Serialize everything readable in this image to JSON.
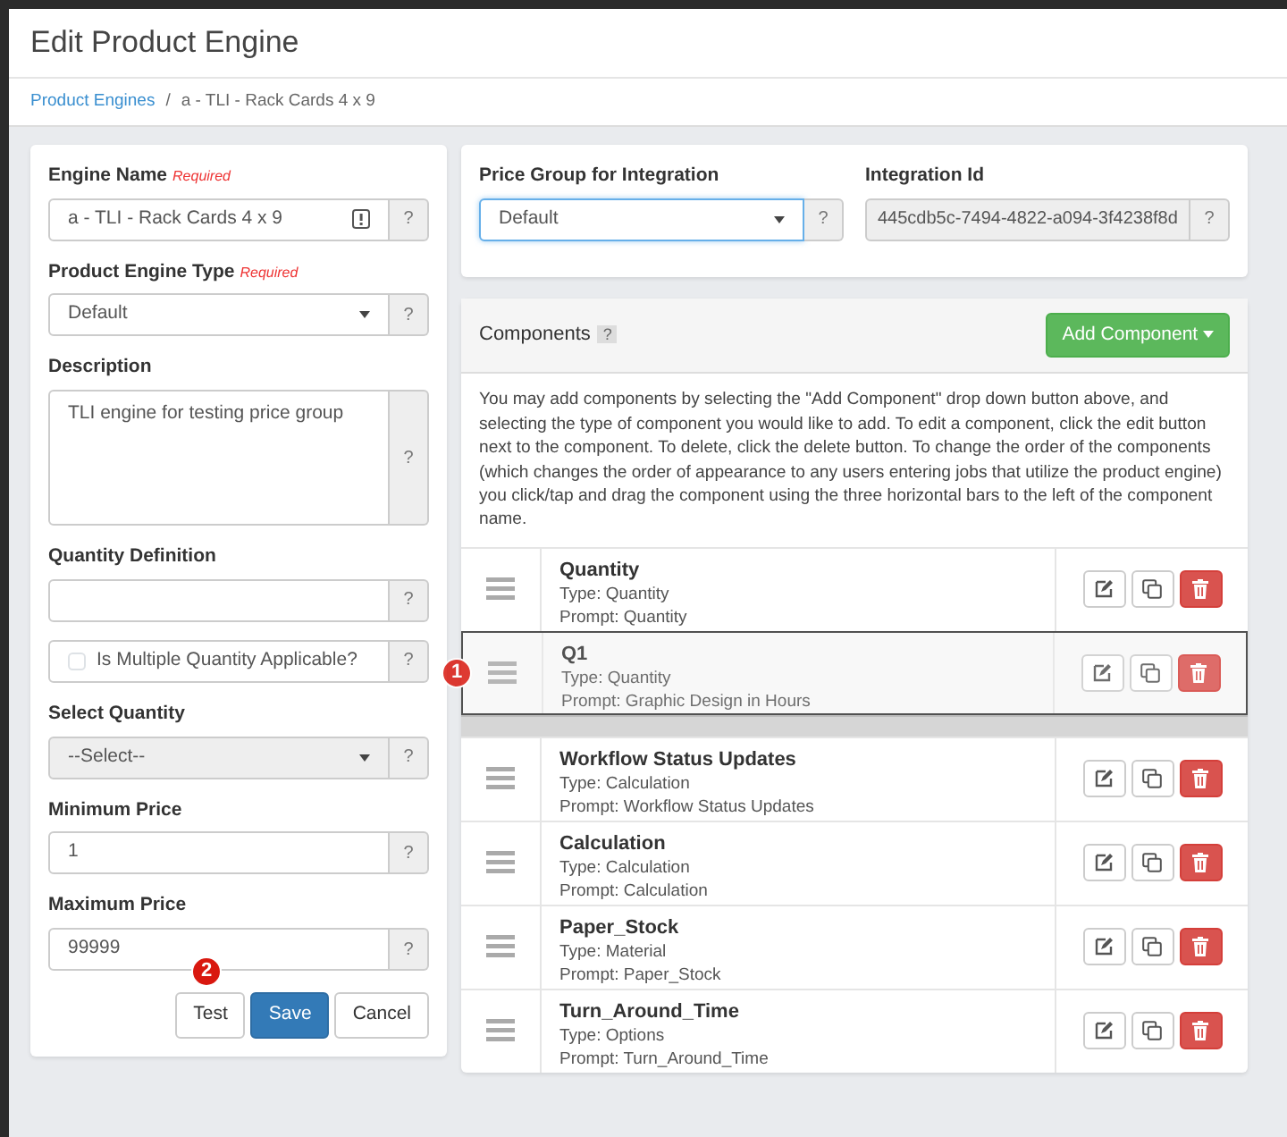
{
  "title": "Edit Product Engine",
  "breadcrumb_separator": "/",
  "breadcrumb": [
    {
      "label": "Product Engines",
      "link": true
    },
    {
      "label": "a - TLI - Rack Cards 4 x 9",
      "link": false
    }
  ],
  "form": {
    "fields": [
      {
        "kind": "text",
        "label": "Engine Name",
        "note": "Required",
        "value": "a - TLI - Rack Cards 4 x 9",
        "warning": true,
        "help": "?"
      },
      {
        "kind": "select",
        "label": "Product Engine Type",
        "note": "Required",
        "value": "Default",
        "disabled": false,
        "help": "?"
      },
      {
        "kind": "textarea",
        "label": "Description",
        "value": "TLI engine for testing price group",
        "help": "?"
      },
      {
        "kind": "text",
        "label": "Quantity Definition",
        "warning": false,
        "help": "?"
      },
      {
        "kind": "checkbox",
        "label": "Is Multiple Quantity Applicable?",
        "checked": false,
        "help": "?"
      },
      {
        "kind": "select",
        "label": "Select Quantity",
        "value": "--Select--",
        "disabled": true,
        "help": "?"
      },
      {
        "kind": "text",
        "label": "Minimum Price",
        "value": "1",
        "warning": false,
        "help": "?"
      },
      {
        "kind": "text",
        "label": "Maximum Price",
        "value": "99999",
        "warning": false,
        "help": "?"
      }
    ],
    "buttons": [
      {
        "label": "Test",
        "kind": "default",
        "marker": "2"
      },
      {
        "label": "Save",
        "kind": "primary"
      },
      {
        "label": "Cancel",
        "kind": "default"
      }
    ]
  },
  "integration": {
    "price_group": {
      "label": "Price Group for Integration",
      "value": "Default",
      "focused": true,
      "help": "?"
    },
    "integration_id": {
      "label": "Integration Id",
      "value": "445cdb5c-7494-4822-a094-3f4238f8d",
      "help": "?"
    }
  },
  "components": {
    "title": "Components",
    "help": "?",
    "add_button": "Add Component",
    "description": "You may add components by selecting the \"Add Component\" drop down button above, and selecting the type of component you would like to add. To edit a component, click the edit button next to the component. To delete, click the delete button. To change the order of the components (which changes the order of appearance to any users entering jobs that utilize the product engine) you click/tap and drag the component using the three horizontal bars to the left of the component name.",
    "items": [
      {
        "kind": "row",
        "name": "Quantity",
        "type": "Type: Quantity",
        "prompt": "Prompt: Quantity"
      },
      {
        "kind": "dragging",
        "name": "Q1",
        "type": "Type: Quantity",
        "prompt": "Prompt: Graphic Design in Hours",
        "marker": "1"
      },
      {
        "kind": "placeholder"
      },
      {
        "kind": "row",
        "name": "Workflow Status Updates",
        "type": "Type: Calculation",
        "prompt": "Prompt: Workflow Status Updates"
      },
      {
        "kind": "row",
        "name": "Calculation",
        "type": "Type: Calculation",
        "prompt": "Prompt: Calculation"
      },
      {
        "kind": "row",
        "name": "Paper_Stock",
        "type": "Type: Material",
        "prompt": "Prompt: Paper_Stock"
      },
      {
        "kind": "row",
        "name": "Turn_Around_Time",
        "type": "Type: Options",
        "prompt": "Prompt: Turn_Around_Time"
      }
    ]
  }
}
